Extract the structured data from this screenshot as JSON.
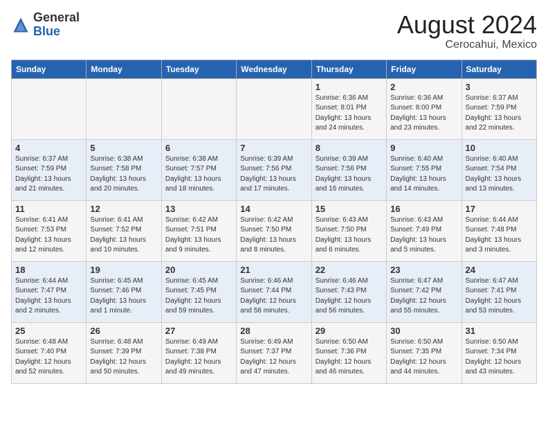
{
  "header": {
    "logo_line1": "General",
    "logo_line2": "Blue",
    "month_year": "August 2024",
    "location": "Cerocahui, Mexico"
  },
  "days_of_week": [
    "Sunday",
    "Monday",
    "Tuesday",
    "Wednesday",
    "Thursday",
    "Friday",
    "Saturday"
  ],
  "weeks": [
    [
      {
        "day": "",
        "info": ""
      },
      {
        "day": "",
        "info": ""
      },
      {
        "day": "",
        "info": ""
      },
      {
        "day": "",
        "info": ""
      },
      {
        "day": "1",
        "info": "Sunrise: 6:36 AM\nSunset: 8:01 PM\nDaylight: 13 hours\nand 24 minutes."
      },
      {
        "day": "2",
        "info": "Sunrise: 6:36 AM\nSunset: 8:00 PM\nDaylight: 13 hours\nand 23 minutes."
      },
      {
        "day": "3",
        "info": "Sunrise: 6:37 AM\nSunset: 7:59 PM\nDaylight: 13 hours\nand 22 minutes."
      }
    ],
    [
      {
        "day": "4",
        "info": "Sunrise: 6:37 AM\nSunset: 7:59 PM\nDaylight: 13 hours\nand 21 minutes."
      },
      {
        "day": "5",
        "info": "Sunrise: 6:38 AM\nSunset: 7:58 PM\nDaylight: 13 hours\nand 20 minutes."
      },
      {
        "day": "6",
        "info": "Sunrise: 6:38 AM\nSunset: 7:57 PM\nDaylight: 13 hours\nand 18 minutes."
      },
      {
        "day": "7",
        "info": "Sunrise: 6:39 AM\nSunset: 7:56 PM\nDaylight: 13 hours\nand 17 minutes."
      },
      {
        "day": "8",
        "info": "Sunrise: 6:39 AM\nSunset: 7:56 PM\nDaylight: 13 hours\nand 16 minutes."
      },
      {
        "day": "9",
        "info": "Sunrise: 6:40 AM\nSunset: 7:55 PM\nDaylight: 13 hours\nand 14 minutes."
      },
      {
        "day": "10",
        "info": "Sunrise: 6:40 AM\nSunset: 7:54 PM\nDaylight: 13 hours\nand 13 minutes."
      }
    ],
    [
      {
        "day": "11",
        "info": "Sunrise: 6:41 AM\nSunset: 7:53 PM\nDaylight: 13 hours\nand 12 minutes."
      },
      {
        "day": "12",
        "info": "Sunrise: 6:41 AM\nSunset: 7:52 PM\nDaylight: 13 hours\nand 10 minutes."
      },
      {
        "day": "13",
        "info": "Sunrise: 6:42 AM\nSunset: 7:51 PM\nDaylight: 13 hours\nand 9 minutes."
      },
      {
        "day": "14",
        "info": "Sunrise: 6:42 AM\nSunset: 7:50 PM\nDaylight: 13 hours\nand 8 minutes."
      },
      {
        "day": "15",
        "info": "Sunrise: 6:43 AM\nSunset: 7:50 PM\nDaylight: 13 hours\nand 6 minutes."
      },
      {
        "day": "16",
        "info": "Sunrise: 6:43 AM\nSunset: 7:49 PM\nDaylight: 13 hours\nand 5 minutes."
      },
      {
        "day": "17",
        "info": "Sunrise: 6:44 AM\nSunset: 7:48 PM\nDaylight: 13 hours\nand 3 minutes."
      }
    ],
    [
      {
        "day": "18",
        "info": "Sunrise: 6:44 AM\nSunset: 7:47 PM\nDaylight: 13 hours\nand 2 minutes."
      },
      {
        "day": "19",
        "info": "Sunrise: 6:45 AM\nSunset: 7:46 PM\nDaylight: 13 hours\nand 1 minute."
      },
      {
        "day": "20",
        "info": "Sunrise: 6:45 AM\nSunset: 7:45 PM\nDaylight: 12 hours\nand 59 minutes."
      },
      {
        "day": "21",
        "info": "Sunrise: 6:46 AM\nSunset: 7:44 PM\nDaylight: 12 hours\nand 58 minutes."
      },
      {
        "day": "22",
        "info": "Sunrise: 6:46 AM\nSunset: 7:43 PM\nDaylight: 12 hours\nand 56 minutes."
      },
      {
        "day": "23",
        "info": "Sunrise: 6:47 AM\nSunset: 7:42 PM\nDaylight: 12 hours\nand 55 minutes."
      },
      {
        "day": "24",
        "info": "Sunrise: 6:47 AM\nSunset: 7:41 PM\nDaylight: 12 hours\nand 53 minutes."
      }
    ],
    [
      {
        "day": "25",
        "info": "Sunrise: 6:48 AM\nSunset: 7:40 PM\nDaylight: 12 hours\nand 52 minutes."
      },
      {
        "day": "26",
        "info": "Sunrise: 6:48 AM\nSunset: 7:39 PM\nDaylight: 12 hours\nand 50 minutes."
      },
      {
        "day": "27",
        "info": "Sunrise: 6:49 AM\nSunset: 7:38 PM\nDaylight: 12 hours\nand 49 minutes."
      },
      {
        "day": "28",
        "info": "Sunrise: 6:49 AM\nSunset: 7:37 PM\nDaylight: 12 hours\nand 47 minutes."
      },
      {
        "day": "29",
        "info": "Sunrise: 6:50 AM\nSunset: 7:36 PM\nDaylight: 12 hours\nand 46 minutes."
      },
      {
        "day": "30",
        "info": "Sunrise: 6:50 AM\nSunset: 7:35 PM\nDaylight: 12 hours\nand 44 minutes."
      },
      {
        "day": "31",
        "info": "Sunrise: 6:50 AM\nSunset: 7:34 PM\nDaylight: 12 hours\nand 43 minutes."
      }
    ]
  ]
}
